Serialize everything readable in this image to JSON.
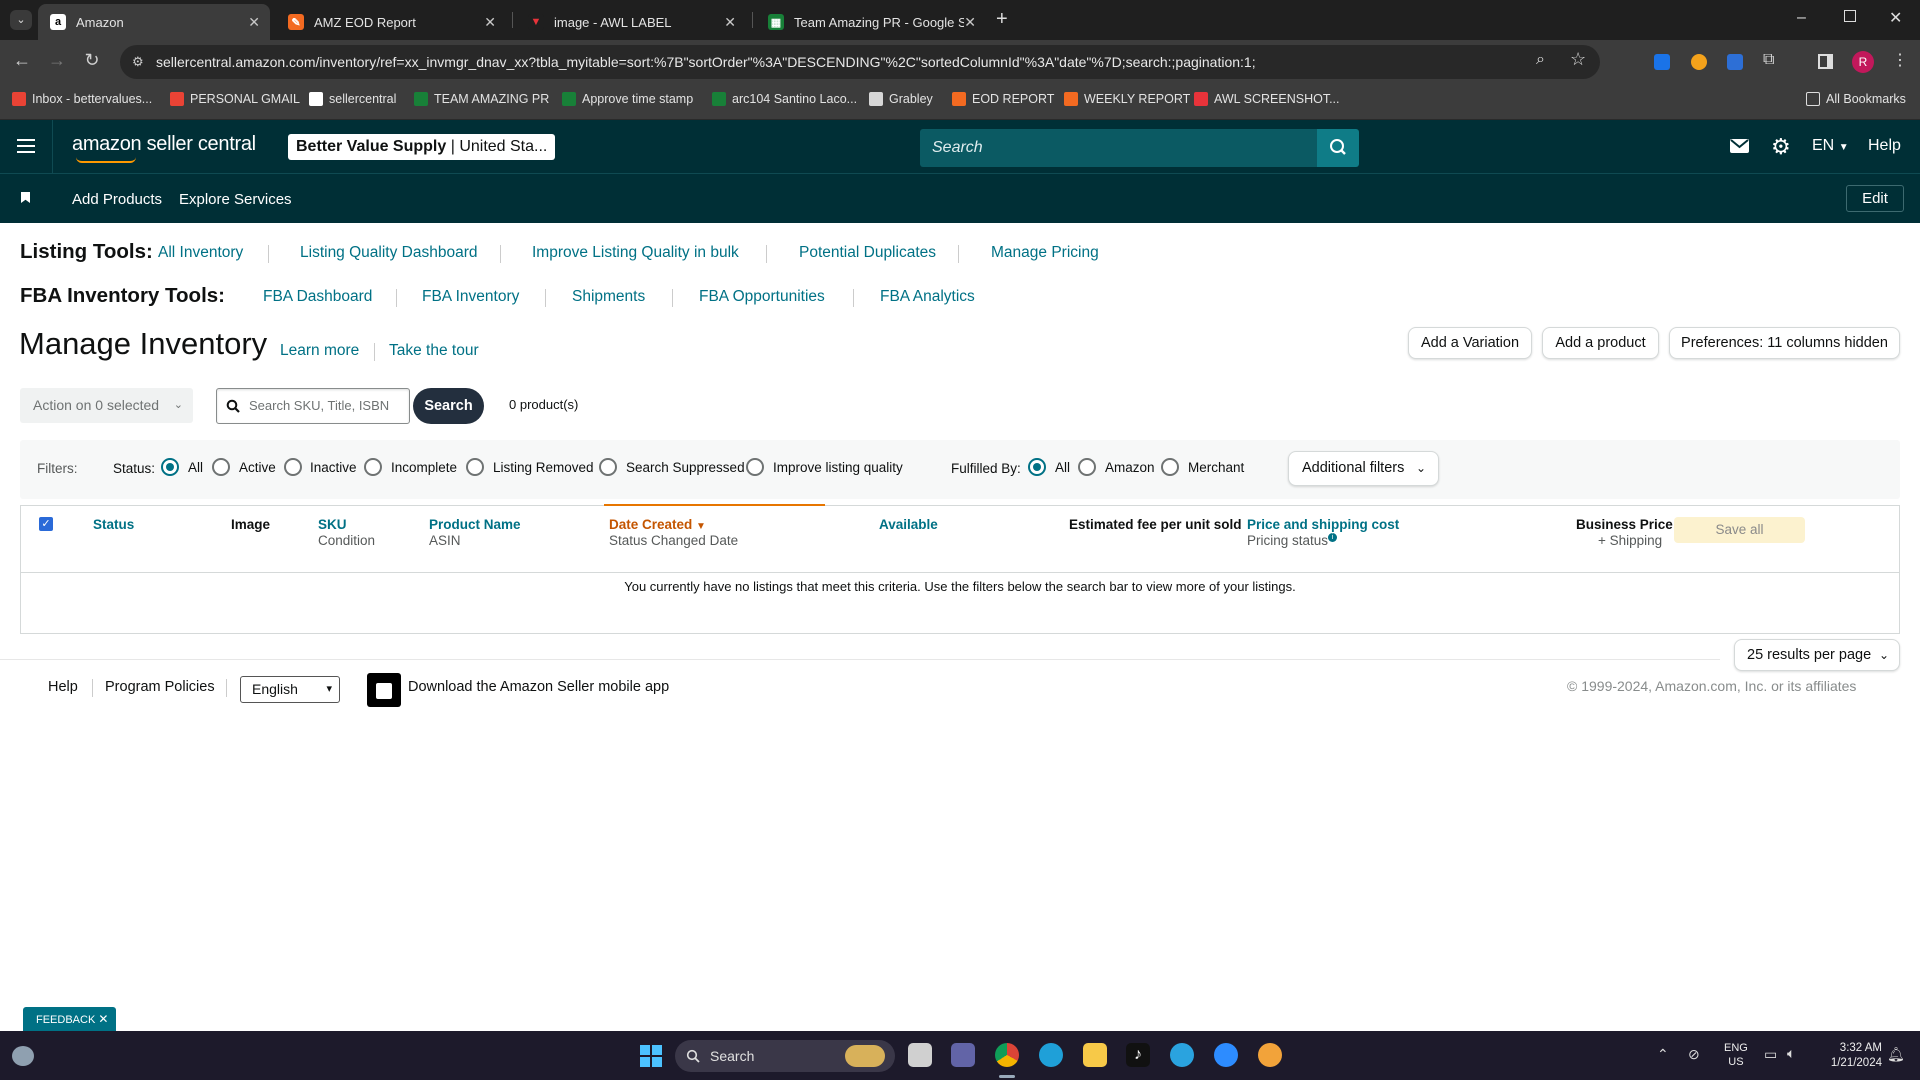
{
  "browser": {
    "tabs": [
      {
        "label": "Amazon",
        "active": true
      },
      {
        "label": "AMZ EOD Report"
      },
      {
        "label": "image - AWL LABEL"
      },
      {
        "label": "Team Amazing PR - Google She"
      }
    ],
    "url": "sellercentral.amazon.com/inventory/ref=xx_invmgr_dnav_xx?tbla_myitable=sort:%7B\"sortOrder\"%3A\"DESCENDING\"%2C\"sortedColumnId\"%3A\"date\"%7D;search:;pagination:1;",
    "profile_initial": "R",
    "bookmarks": [
      "Inbox - bettervalues...",
      "PERSONAL GMAIL",
      "sellercentral",
      "TEAM AMAZING PR",
      "Approve time stamp",
      "arc104 Santino Laco...",
      "Grabley",
      "EOD REPORT",
      "WEEKLY REPORT",
      "AWL SCREENSHOT...",
      "All Bookmarks"
    ]
  },
  "header": {
    "logo": "amazon seller central",
    "store_name": "Better Value Supply",
    "store_region": "United Sta...",
    "search_placeholder": "Search",
    "lang": "EN",
    "help": "Help"
  },
  "subnav": {
    "add_products": "Add Products",
    "explore_services": "Explore Services",
    "edit": "Edit"
  },
  "listing_tools": {
    "label": "Listing Tools:",
    "links": [
      "All Inventory",
      "Listing Quality Dashboard",
      "Improve Listing Quality in bulk",
      "Potential Duplicates",
      "Manage Pricing"
    ]
  },
  "fba_tools": {
    "label": "FBA Inventory Tools:",
    "links": [
      "FBA Dashboard",
      "FBA Inventory",
      "Shipments",
      "FBA Opportunities",
      "FBA Analytics"
    ]
  },
  "page": {
    "title": "Manage Inventory",
    "learn_more": "Learn more",
    "take_tour": "Take the tour",
    "add_variation": "Add a Variation",
    "add_product": "Add a product",
    "preferences": "Preferences: 11 columns hidden",
    "action": "Action on 0 selected",
    "search_placeholder": "Search SKU, Title, ISBN",
    "search_button": "Search",
    "product_count": "0 product(s)"
  },
  "filters": {
    "label": "Filters:",
    "status_label": "Status:",
    "status_options": [
      "All",
      "Active",
      "Inactive",
      "Incomplete",
      "Listing Removed",
      "Search Suppressed",
      "Improve listing quality"
    ],
    "fulfilled_label": "Fulfilled By:",
    "fulfilled_options": [
      "All",
      "Amazon",
      "Merchant"
    ],
    "additional": "Additional filters"
  },
  "table": {
    "status": "Status",
    "image": "Image",
    "sku": "SKU",
    "condition": "Condition",
    "product_name": "Product Name",
    "asin": "ASIN",
    "date_created": "Date Created",
    "status_changed": "Status Changed Date",
    "available": "Available",
    "fee": "Estimated fee per unit sold",
    "price_shipping": "Price and shipping cost",
    "pricing_status": "Pricing status",
    "business_price": "Business Price",
    "plus_shipping": "+ Shipping",
    "save_all": "Save all",
    "empty_message": "You currently have no listings that meet this criteria. Use the filters below the search bar to view more of your listings.",
    "per_page": "25 results per page"
  },
  "footer": {
    "help": "Help",
    "policies": "Program Policies",
    "language": "English",
    "app": "Download the Amazon Seller mobile app",
    "copyright": "© 1999-2024, Amazon.com, Inc. or its affiliates",
    "feedback": "FEEDBACK"
  },
  "taskbar": {
    "search": "Search",
    "lang1": "ENG",
    "lang2": "US",
    "time": "3:32 AM",
    "date": "1/21/2024"
  }
}
